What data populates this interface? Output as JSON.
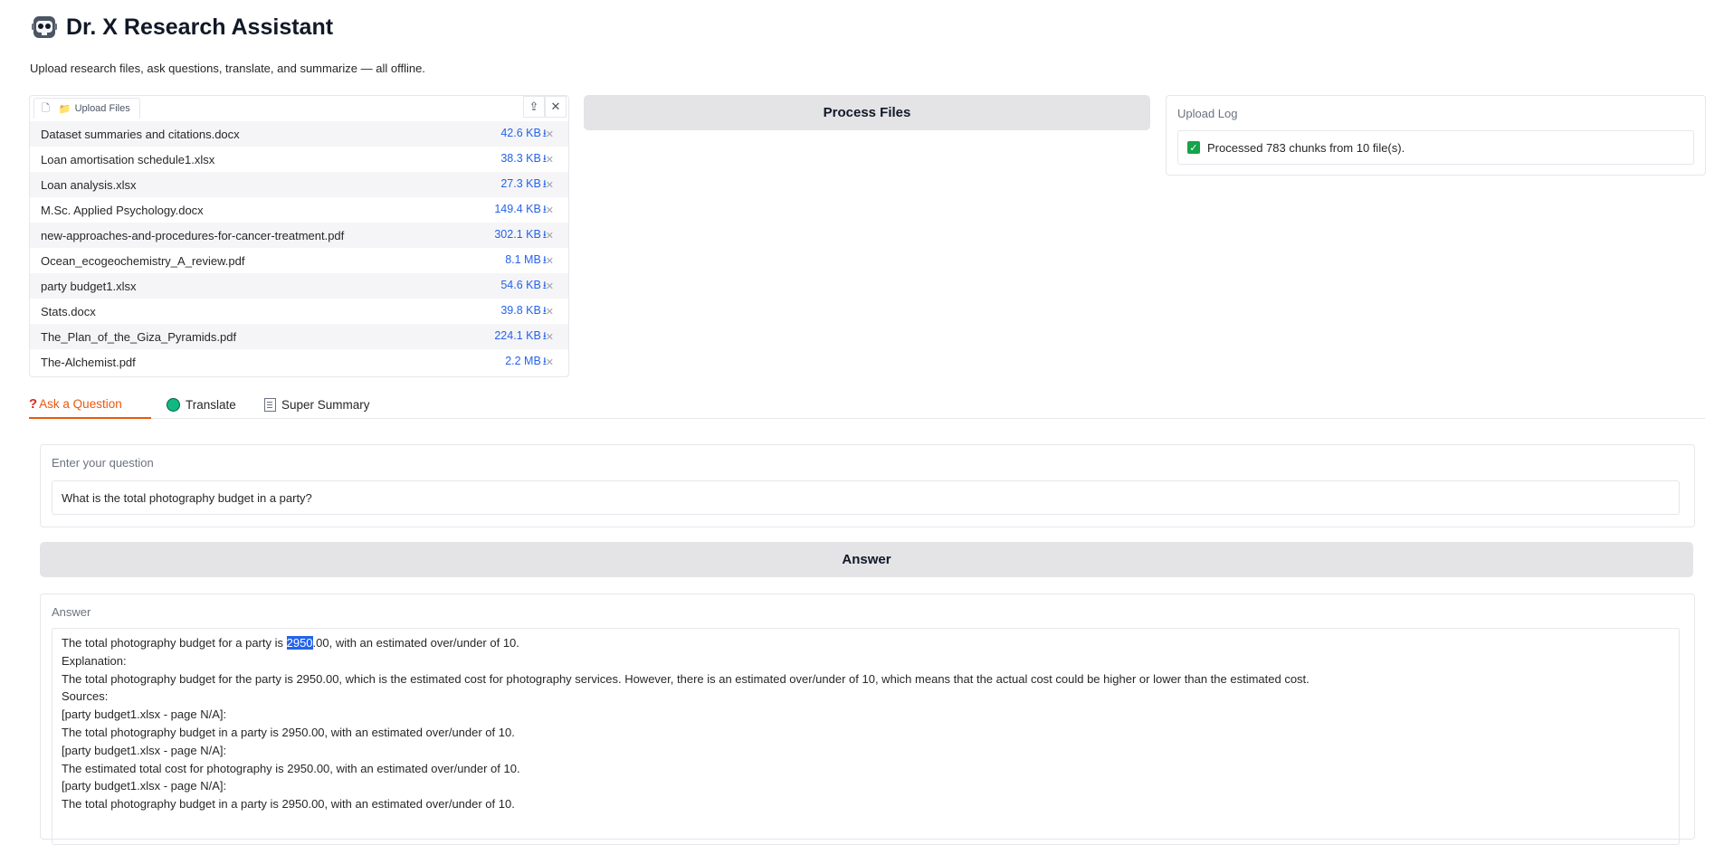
{
  "header": {
    "title": "Dr. X Research Assistant",
    "subtitle": "Upload research files, ask questions, translate, and summarize — all offline."
  },
  "upload": {
    "tab_label": "Upload Files",
    "files": [
      {
        "name": "Dataset summaries and citations.docx",
        "size": "42.6 KB"
      },
      {
        "name": "Loan amortisation schedule1.xlsx",
        "size": "38.3 KB"
      },
      {
        "name": "Loan analysis.xlsx",
        "size": "27.3 KB"
      },
      {
        "name": "M.Sc. Applied Psychology.docx",
        "size": "149.4 KB"
      },
      {
        "name": "new-approaches-and-procedures-for-cancer-treatment.pdf",
        "size": "302.1 KB"
      },
      {
        "name": "Ocean_ecogeochemistry_A_review.pdf",
        "size": "8.1 MB"
      },
      {
        "name": "party budget1.xlsx",
        "size": "54.6 KB"
      },
      {
        "name": "Stats.docx",
        "size": "39.8 KB"
      },
      {
        "name": "The_Plan_of_the_Giza_Pyramids.pdf",
        "size": "224.1 KB"
      },
      {
        "name": "The-Alchemist.pdf",
        "size": "2.2 MB"
      }
    ]
  },
  "process_button": "Process Files",
  "log": {
    "label": "Upload Log",
    "message": "Processed 783 chunks from 10 file(s)."
  },
  "tabs": [
    {
      "label": "Ask a Question"
    },
    {
      "label": "Translate"
    },
    {
      "label": "Super Summary"
    }
  ],
  "question": {
    "label": "Enter your question",
    "value": "What is the total photography budget in a party?"
  },
  "answer_button": "Answer",
  "answer": {
    "label": "Answer",
    "first_line": {
      "before": "The total photography budget for a party is ",
      "highlight": "2950",
      "after": ".00, with an estimated over/under of 10."
    },
    "lines": [
      "Explanation:",
      "The total photography budget for the party is 2950.00, which is the estimated cost for photography services. However, there is an estimated over/under of 10, which means that the actual cost could be higher or lower than the estimated cost.",
      "Sources:",
      "[party budget1.xlsx - page N/A]:",
      "The total photography budget in a party is 2950.00, with an estimated over/under of 10.",
      "[party budget1.xlsx - page N/A]:",
      "The estimated total cost for photography is 2950.00, with an estimated over/under of 10.",
      "[party budget1.xlsx - page N/A]:",
      "The total photography budget in a party is 2950.00, with an estimated over/under of 10."
    ]
  }
}
